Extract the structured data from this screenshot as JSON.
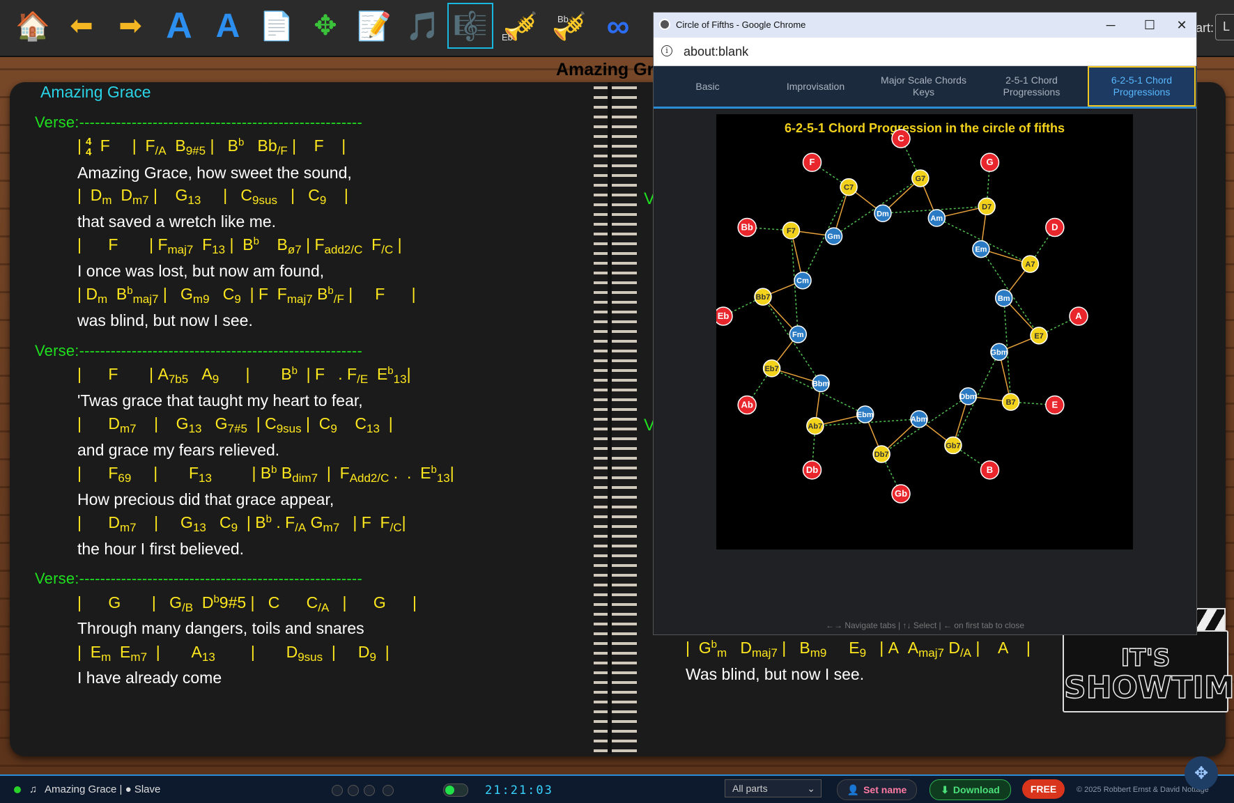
{
  "toolbar": {
    "icons": [
      "🏠",
      "⬅",
      "➡",
      "A",
      "A",
      "📄",
      "🔀",
      "📝",
      "🎵",
      "🎼",
      "🎺",
      "🎺",
      "∞"
    ],
    "eb_label": "Eb",
    "bb_label": "Bb",
    "part_label": "art:",
    "part_box": "L"
  },
  "banner_title": "Amazing Gr",
  "song": {
    "title": "Amazing Grace",
    "verse_label": "Verse:------------------------------------------------------",
    "right_verse_label": "V"
  },
  "lines": {
    "l1_chords": "|4/4  F    |  F/A  B9#5 |  Bb  Bb/F |   F    |",
    "l1_lyric": "Amazing Grace, how sweet the sound,",
    "l2_lyric": "that saved a wretch like me.",
    "l3_lyric": "I once was lost, but now am found,",
    "l4_lyric": "was blind, but now I see.",
    "l5_lyric": "'Twas grace that taught my heart to fear,",
    "l6_lyric": "and grace my fears relieved.",
    "l7_lyric": "How precious did that grace appear,",
    "l8_lyric": "the hour I first believed.",
    "l9_lyric": "Through many dangers, toils and snares",
    "l10_lyric": "I have already come",
    "r_lyric": "Was blind, but now I see."
  },
  "popup": {
    "window_title": "Circle of Fifths - Google Chrome",
    "url": "about:blank",
    "tabs": [
      {
        "label": "Basic"
      },
      {
        "label": "Improvisation"
      },
      {
        "label": "Major Scale Chords Keys"
      },
      {
        "label": "2-5-1 Chord Progressions"
      },
      {
        "label": "6-2-5-1 Chord Progressions"
      }
    ],
    "active_tab": 4,
    "figure_title": "6-2-5-1 Chord Progression in the circle of fifths",
    "hint": "←→ Navigate tabs | ↑↓ Select | ← on first tab to close",
    "keys": [
      "C",
      "G",
      "D",
      "A",
      "E",
      "B",
      "Gb",
      "Db",
      "Ab",
      "Eb",
      "Bb",
      "F"
    ],
    "colors": {
      "key": "#e8262c",
      "dom7": "#f2d21b",
      "minor": "#2a7bc4"
    }
  },
  "showtime": {
    "line1": "IT'S",
    "line2": "SHOWTIME"
  },
  "status": {
    "song": "Amazing Grace | ● Slave",
    "clock": "21:21:03",
    "parts_select": "All parts",
    "set_name": "Set name",
    "download": "Download",
    "free": "FREE",
    "copyright": "© 2025 Robbert Ernst & David Nottage"
  }
}
